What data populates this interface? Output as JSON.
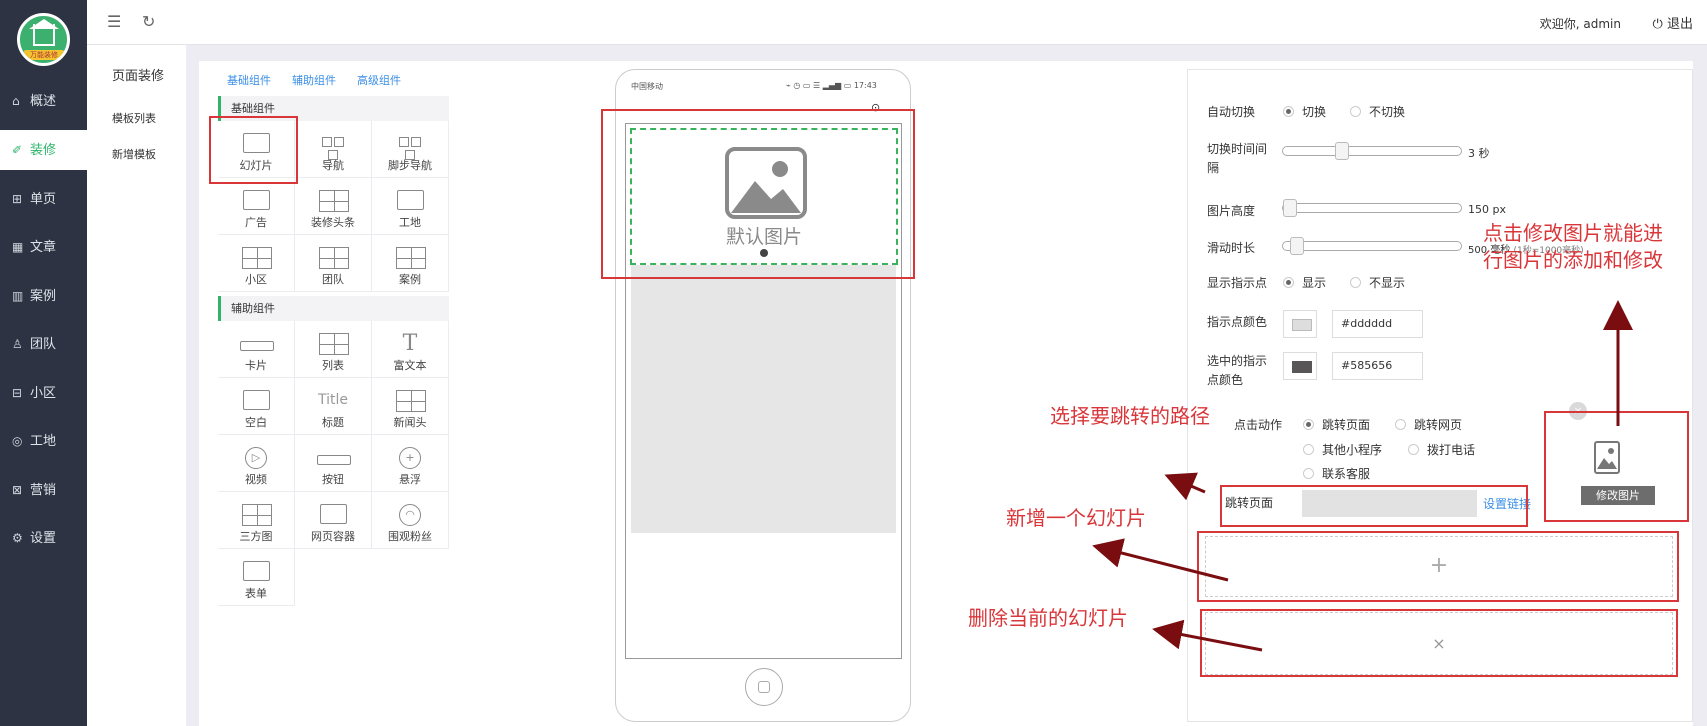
{
  "brand": {
    "logo_text": "万能装修"
  },
  "nav": {
    "items": [
      {
        "icon": "home-icon",
        "glyph": "⌂",
        "label": "概述"
      },
      {
        "icon": "brush-icon",
        "glyph": "✐",
        "label": "装修"
      },
      {
        "icon": "page-icon",
        "glyph": "⊞",
        "label": "单页"
      },
      {
        "icon": "article-icon",
        "glyph": "▦",
        "label": "文章"
      },
      {
        "icon": "case-icon",
        "glyph": "▥",
        "label": "案例"
      },
      {
        "icon": "team-icon",
        "glyph": "♙",
        "label": "团队"
      },
      {
        "icon": "community-icon",
        "glyph": "⊟",
        "label": "小区"
      },
      {
        "icon": "site-icon",
        "glyph": "◎",
        "label": "工地"
      },
      {
        "icon": "marketing-icon",
        "glyph": "⊠",
        "label": "营销"
      },
      {
        "icon": "settings-icon",
        "glyph": "⚙",
        "label": "设置"
      }
    ],
    "active_color": "#2fb46a"
  },
  "topbar": {
    "welcome": "欢迎你, admin",
    "logout": "退出"
  },
  "submenu": {
    "title": "页面装修",
    "items": [
      "模板列表",
      "新增模板"
    ]
  },
  "component_tabs": [
    "基础组件",
    "辅助组件",
    "高级组件"
  ],
  "basic_section": {
    "title": "基础组件",
    "items": [
      "幻灯片",
      "导航",
      "脚步导航",
      "广告",
      "装修头条",
      "工地",
      "小区",
      "团队",
      "案例"
    ]
  },
  "aux_section": {
    "title": "辅助组件",
    "items": [
      "卡片",
      "列表",
      "富文本",
      "空白",
      "标题",
      "新闻头",
      "视频",
      "按钮",
      "悬浮",
      "三方图",
      "网页容器",
      "围观粉丝",
      "表单"
    ],
    "title_glyph": "Title"
  },
  "phone": {
    "carrier": "中国移动",
    "time": "17:43",
    "status_icons": "⌁ ◷ ▭ ☰ ▂▄▆ ▭",
    "placeholder": "默认图片"
  },
  "settings": {
    "autoplay": {
      "label": "自动切换",
      "on": "切换",
      "off": "不切换"
    },
    "interval": {
      "label": "切换时间间隔",
      "value": "3",
      "unit": "秒",
      "level": 0.32
    },
    "height": {
      "label": "图片高度",
      "value": "150",
      "unit": "px",
      "level": 0.0
    },
    "slide_duration": {
      "label": "滑动时长",
      "value": "500",
      "unit": "毫秒",
      "note": "(1秒=1000毫秒)",
      "level": 0.04
    },
    "indicator": {
      "label": "显示指示点",
      "on": "显示",
      "off": "不显示"
    },
    "dot_color": {
      "label": "指示点颜色",
      "value": "#dddddd"
    },
    "active_dot_color": {
      "label": "选中的指示点颜色",
      "value": "#585656"
    },
    "click_action": {
      "label": "点击动作",
      "options": [
        "跳转页面",
        "跳转网页",
        "其他小程序",
        "拨打电话",
        "联系客服"
      ]
    },
    "jump": {
      "label": "跳转页面",
      "link": "设置链接"
    },
    "edit_image": "修改图片",
    "add_symbol": "+",
    "delete_symbol": "×"
  },
  "annotations": {
    "edit_image": [
      "点击修改图片就能进",
      "行图片的添加和修改"
    ],
    "route": "选择要跳转的路径",
    "add": "新增一个幻灯片",
    "delete": "删除当前的幻灯片",
    "color": "#d9363a"
  }
}
